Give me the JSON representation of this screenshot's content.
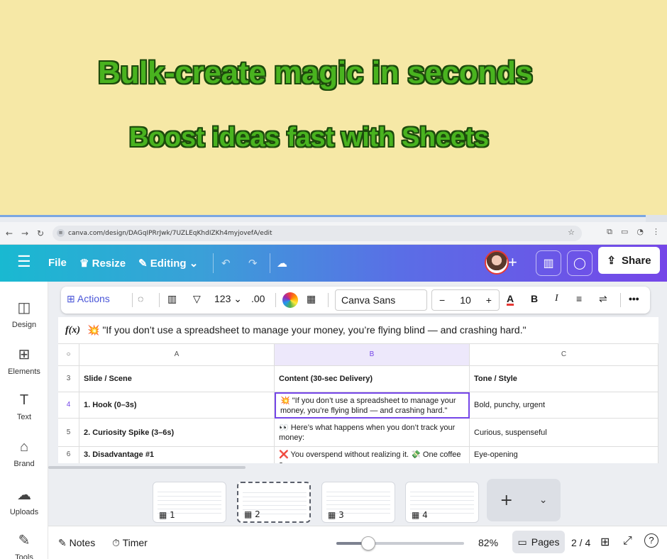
{
  "promo": {
    "headline": "Bulk-create magic in seconds",
    "subheadline": "Boost ideas fast with Sheets"
  },
  "browser": {
    "url": "canva.com/design/DAGqIPRrJwk/7UZLEqKhdIZKh4myjovefA/edit"
  },
  "topbar": {
    "file": "File",
    "resize": "Resize",
    "editing": "Editing",
    "share": "Share"
  },
  "sidebar": {
    "items": [
      {
        "label": "Design"
      },
      {
        "label": "Elements"
      },
      {
        "label": "Text"
      },
      {
        "label": "Brand"
      },
      {
        "label": "Uploads"
      },
      {
        "label": "Tools"
      }
    ]
  },
  "toolbar": {
    "actions": "Actions",
    "number_format": "123",
    "decimals": ".00",
    "font": "Canva Sans",
    "font_size": "10"
  },
  "sheet": {
    "formula_label": "f(x)",
    "formula": "💥 \"If you don’t use a spreadsheet to manage your money, you’re flying blind — and crashing hard.\"",
    "columns": [
      "A",
      "B",
      "C"
    ],
    "rows": [
      {
        "num": "3",
        "a": "Slide / Scene",
        "b": "Content (30-sec Delivery)",
        "c": "Tone / Style"
      },
      {
        "num": "4",
        "a": "1. Hook (0–3s)",
        "b": "💥 \"If you don’t use a spreadsheet to manage your money, you’re flying blind — and crashing hard.\"",
        "c": "Bold, punchy, urgent"
      },
      {
        "num": "5",
        "a": "2. Curiosity Spike (3–6s)",
        "b": "👀 Here’s what happens when you don’t track your money:",
        "c": "Curious, suspenseful"
      },
      {
        "num": "6",
        "a": "3. Disadvantage #1",
        "b": "❌ You overspend without realizing it. 💸 One coffee a",
        "c": "Eye-opening"
      }
    ]
  },
  "pages": {
    "thumbs": [
      {
        "num": "1"
      },
      {
        "num": "2"
      },
      {
        "num": "3"
      },
      {
        "num": "4"
      }
    ],
    "current": "2 / 4"
  },
  "bottombar": {
    "notes": "Notes",
    "timer": "Timer",
    "zoom": "82%",
    "zoom_level": 0.25,
    "pages": "Pages"
  },
  "colors": {
    "accent": "#7546e8",
    "headline_green": "#49b31f",
    "background": "#f6e8a6"
  }
}
